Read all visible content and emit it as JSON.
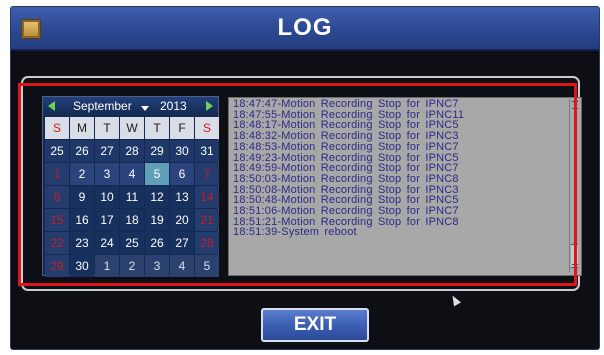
{
  "title": "LOG",
  "calendar": {
    "month": "September",
    "year": "2013",
    "weekdays": [
      "S",
      "M",
      "T",
      "W",
      "T",
      "F",
      "S"
    ],
    "rows": [
      [
        "25",
        "26",
        "27",
        "28",
        "29",
        "30",
        "31"
      ],
      [
        "1",
        "2",
        "3",
        "4",
        "5",
        "6",
        "7"
      ],
      [
        "8",
        "9",
        "10",
        "11",
        "12",
        "13",
        "14"
      ],
      [
        "15",
        "16",
        "17",
        "18",
        "19",
        "20",
        "21"
      ],
      [
        "22",
        "23",
        "24",
        "25",
        "26",
        "27",
        "28"
      ],
      [
        "29",
        "30",
        "1",
        "2",
        "3",
        "4",
        "5"
      ]
    ],
    "selected": "5"
  },
  "log_lines": [
    "18:47:47-Motion Recording Stop for IPNC7",
    "18:47:55-Motion Recording Stop for IPNC11",
    "18:48:17-Motion Recording Stop for IPNC5",
    "18:48:32-Motion Recording Stop for IPNC3",
    "18:48:53-Motion Recording Stop for IPNC7",
    "18:49:23-Motion Recording Stop for IPNC5",
    "18:49:59-Motion Recording Stop for IPNC7",
    "18:50:03-Motion Recording Stop for IPNC8",
    "18:50:08-Motion Recording Stop for IPNC3",
    "18:50:48-Motion Recording Stop for IPNC5",
    "18:51:06-Motion Recording Stop for IPNC7",
    "18:51:21-Motion Recording Stop for IPNC8",
    "18:51:39-System reboot"
  ],
  "exit_label": "EXIT",
  "colors": {
    "title_bar": "#2b4892",
    "calendar_bg": "#142a52",
    "selected_day": "#5f9fb8",
    "weekend_red": "#e03030",
    "log_bg": "#a8a8a8",
    "log_text": "#2a2a8a",
    "highlight_box": "#e0151b"
  },
  "icons": {
    "menu": "menu-icon",
    "prev_month": "arrow-left-icon",
    "next_month": "arrow-right-icon",
    "month_dropdown": "chevron-down-icon",
    "cursor": "mouse-cursor-icon"
  }
}
